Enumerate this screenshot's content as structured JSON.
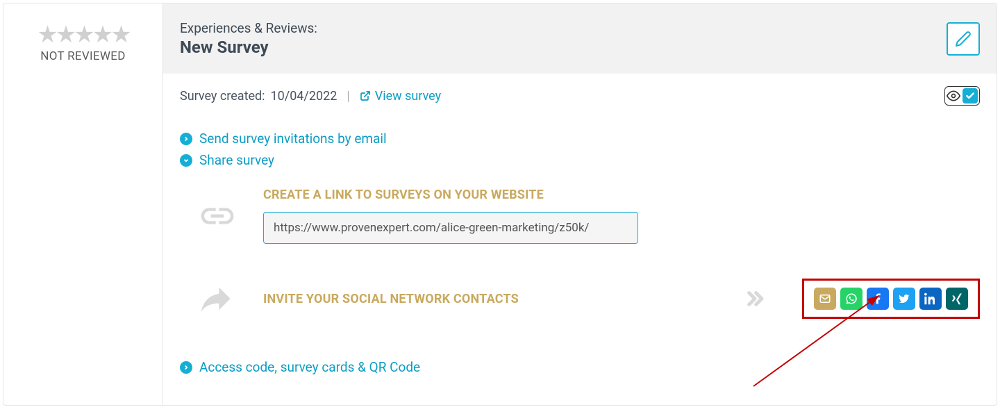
{
  "sidebar": {
    "not_reviewed": "NOT REVIEWED"
  },
  "header": {
    "sub": "Experiences & Reviews:",
    "title": "New Survey"
  },
  "meta": {
    "created_label": "Survey created:",
    "created_date": "10/04/2022",
    "view_label": "View survey"
  },
  "actions": {
    "send_invites": "Send survey invitations by email",
    "share_survey": "Share survey",
    "access_code": "Access code, survey cards & QR Code"
  },
  "link_section": {
    "heading": "CREATE A LINK TO SURVEYS ON YOUR WEBSITE",
    "url": "https://www.provenexpert.com/alice-green-marketing/z50k/"
  },
  "social_section": {
    "heading": "INVITE YOUR SOCIAL NETWORK CONTACTS"
  }
}
